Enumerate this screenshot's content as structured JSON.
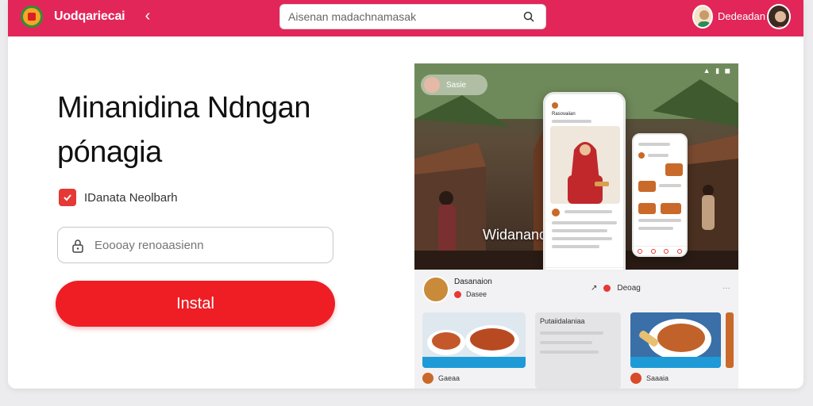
{
  "header": {
    "app_name": "Uodqariecai",
    "search_placeholder": "Aisenan madachnamasak",
    "user_name": "Dedeadan"
  },
  "hero": {
    "title_line1": "Minanidina Ndngan",
    "title_line2": "pónagia",
    "checkbox_label": "IDanata Neolbarh",
    "field_placeholder": "Eoooay renoaasienn",
    "install_label": "Instal"
  },
  "preview": {
    "chip_label": "Sasie",
    "overlay_text": "Widanandi",
    "phone_title": "Rasovaiian",
    "card_title": "Dasanaion",
    "card_subtitle": "Dasee",
    "card_right": "Deoag",
    "mid_card_title": "Putaiidalaniaa",
    "bottom_left": "Gaeaa",
    "bottom_right": "Saaaia"
  },
  "colors": {
    "topbar": "#e2265a",
    "install": "#ef1e24",
    "accent_blue": "#1e9bd7"
  },
  "icons": {
    "back": "chevron-left-icon",
    "search": "search-icon",
    "lock": "lock-icon",
    "check": "check-icon"
  }
}
